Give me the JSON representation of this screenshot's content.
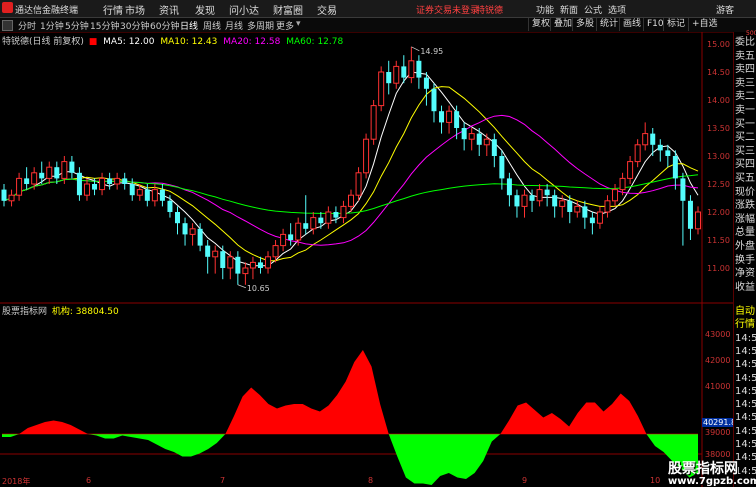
{
  "app": {
    "title": "通达信金融终端"
  },
  "menu": [
    "行情",
    "市场",
    "资讯",
    "发现",
    "问小达",
    "财富圈",
    "交易"
  ],
  "notice": {
    "login": "证券交易未登录",
    "stock": "特锐德"
  },
  "right_menu": [
    "功能",
    "新面",
    "公式",
    "选项",
    "游客"
  ],
  "toolbar": {
    "periods": [
      "分时",
      "1分钟",
      "5分钟",
      "15分钟",
      "30分钟",
      "60分钟",
      "日线",
      "周线",
      "月线",
      "多周期",
      "更多"
    ],
    "active": "日线",
    "right": [
      "复权",
      "叠加",
      "多股",
      "统计",
      "画线",
      "F10",
      "标记",
      "+自选"
    ]
  },
  "main_chart": {
    "title": "特锐德(日线 前复权)",
    "ma": [
      {
        "label": "MA5: 12.00",
        "color": "#ffffff"
      },
      {
        "label": "MA10: 12.43",
        "color": "#ffff00"
      },
      {
        "label": "MA20: 12.58",
        "color": "#ff00ff"
      },
      {
        "label": "MA60: 12.78",
        "color": "#00ff00"
      }
    ],
    "high_label": "14.95",
    "low_label": "10.65",
    "y_ticks": [
      "15.00",
      "14.50",
      "14.00",
      "13.50",
      "13.00",
      "12.50",
      "12.00",
      "11.50",
      "11.00"
    ]
  },
  "indicator": {
    "title": "股票指标网",
    "label": "机构: 38804.50",
    "current": "40291.8",
    "y_ticks": [
      "43000",
      "42000",
      "41000",
      "40000",
      "39000",
      "38000"
    ]
  },
  "x_axis": [
    "2018年",
    "6",
    "7",
    "8",
    "9",
    "10"
  ],
  "side_panel": {
    "top": "500",
    "items_top": [
      "委比",
      "卖五",
      "卖四",
      "卖三",
      "卖二",
      "卖一",
      "买一",
      "买二",
      "买三",
      "买四",
      "买五",
      "现价",
      "涨跌",
      "涨幅",
      "总量",
      "外盘",
      "换手",
      "净资",
      "收益"
    ],
    "items_bottom": [
      "自动",
      "行情",
      "14:5",
      "14:5",
      "14:5",
      "14:5",
      "14:5",
      "14:5",
      "14:5",
      "14:5",
      "14:5",
      "14:5",
      "14:5"
    ]
  },
  "watermark": {
    "text": "股票指标网",
    "url": "www.7gpzb.com"
  },
  "chart_data": {
    "type": "line",
    "candles": [
      [
        12.4,
        12.2,
        12.5,
        12.1
      ],
      [
        12.2,
        12.3,
        12.4,
        12.1
      ],
      [
        12.3,
        12.6,
        12.7,
        12.2
      ],
      [
        12.6,
        12.5,
        12.8,
        12.4
      ],
      [
        12.5,
        12.7,
        12.8,
        12.4
      ],
      [
        12.7,
        12.6,
        12.9,
        12.5
      ],
      [
        12.6,
        12.8,
        12.9,
        12.5
      ],
      [
        12.8,
        12.6,
        12.9,
        12.5
      ],
      [
        12.6,
        12.9,
        13.0,
        12.5
      ],
      [
        12.9,
        12.7,
        13.0,
        12.6
      ],
      [
        12.7,
        12.3,
        12.8,
        12.2
      ],
      [
        12.3,
        12.5,
        12.6,
        12.2
      ],
      [
        12.5,
        12.4,
        12.6,
        12.3
      ],
      [
        12.4,
        12.6,
        12.7,
        12.3
      ],
      [
        12.6,
        12.5,
        12.7,
        12.4
      ],
      [
        12.5,
        12.6,
        12.7,
        12.4
      ],
      [
        12.6,
        12.5,
        12.7,
        12.4
      ],
      [
        12.5,
        12.3,
        12.6,
        12.2
      ],
      [
        12.3,
        12.4,
        12.5,
        12.2
      ],
      [
        12.4,
        12.2,
        12.5,
        12.1
      ],
      [
        12.2,
        12.4,
        12.5,
        12.1
      ],
      [
        12.4,
        12.2,
        12.5,
        12.1
      ],
      [
        12.2,
        12.0,
        12.3,
        11.9
      ],
      [
        12.0,
        11.8,
        12.1,
        11.6
      ],
      [
        11.8,
        11.6,
        11.9,
        11.4
      ],
      [
        11.6,
        11.7,
        11.8,
        11.4
      ],
      [
        11.7,
        11.4,
        11.8,
        11.3
      ],
      [
        11.4,
        11.2,
        11.5,
        10.9
      ],
      [
        11.2,
        11.3,
        11.4,
        10.9
      ],
      [
        11.3,
        11.0,
        11.4,
        10.8
      ],
      [
        11.0,
        11.2,
        11.3,
        10.8
      ],
      [
        11.2,
        10.9,
        11.3,
        10.7
      ],
      [
        10.9,
        11.0,
        11.1,
        10.7
      ],
      [
        11.0,
        11.1,
        11.2,
        10.8
      ],
      [
        11.1,
        11.0,
        11.2,
        10.9
      ],
      [
        11.0,
        11.2,
        11.3,
        10.9
      ],
      [
        11.2,
        11.4,
        11.5,
        11.1
      ],
      [
        11.4,
        11.6,
        11.7,
        11.3
      ],
      [
        11.6,
        11.5,
        11.8,
        11.4
      ],
      [
        11.5,
        11.8,
        11.9,
        11.4
      ],
      [
        11.8,
        11.7,
        12.3,
        11.6
      ],
      [
        11.7,
        11.9,
        12.0,
        11.6
      ],
      [
        11.9,
        11.8,
        12.0,
        11.7
      ],
      [
        11.8,
        12.0,
        12.1,
        11.7
      ],
      [
        12.0,
        11.9,
        12.1,
        11.8
      ],
      [
        11.9,
        12.1,
        12.2,
        11.8
      ],
      [
        12.1,
        12.3,
        12.4,
        12.0
      ],
      [
        12.3,
        12.7,
        12.8,
        12.2
      ],
      [
        12.7,
        13.3,
        13.4,
        12.6
      ],
      [
        13.3,
        13.9,
        14.0,
        13.2
      ],
      [
        13.9,
        14.5,
        14.6,
        13.8
      ],
      [
        14.5,
        14.3,
        14.7,
        14.1
      ],
      [
        14.3,
        14.6,
        14.7,
        14.2
      ],
      [
        14.6,
        14.4,
        14.8,
        14.3
      ],
      [
        14.4,
        14.7,
        14.95,
        14.3
      ],
      [
        14.7,
        14.4,
        14.8,
        14.2
      ],
      [
        14.4,
        14.2,
        14.5,
        13.9
      ],
      [
        14.2,
        13.8,
        14.3,
        13.6
      ],
      [
        13.8,
        13.6,
        13.9,
        13.4
      ],
      [
        13.6,
        13.8,
        13.9,
        13.4
      ],
      [
        13.8,
        13.5,
        13.9,
        13.3
      ],
      [
        13.5,
        13.3,
        13.6,
        13.1
      ],
      [
        13.3,
        13.4,
        13.5,
        13.1
      ],
      [
        13.4,
        13.2,
        13.5,
        13.0
      ],
      [
        13.2,
        13.3,
        13.4,
        13.0
      ],
      [
        13.3,
        13.0,
        13.4,
        12.8
      ],
      [
        13.0,
        12.6,
        13.1,
        12.4
      ],
      [
        12.6,
        12.3,
        12.7,
        12.1
      ],
      [
        12.3,
        12.1,
        12.4,
        11.9
      ],
      [
        12.1,
        12.3,
        12.4,
        11.9
      ],
      [
        12.3,
        12.2,
        12.4,
        12.0
      ],
      [
        12.2,
        12.4,
        12.5,
        12.1
      ],
      [
        12.4,
        12.3,
        12.5,
        12.1
      ],
      [
        12.3,
        12.1,
        12.4,
        11.9
      ],
      [
        12.1,
        12.2,
        12.3,
        11.9
      ],
      [
        12.2,
        12.0,
        12.3,
        11.8
      ],
      [
        12.0,
        12.1,
        12.2,
        11.9
      ],
      [
        12.1,
        11.9,
        12.2,
        11.7
      ],
      [
        11.9,
        11.8,
        12.0,
        11.6
      ],
      [
        11.8,
        12.0,
        12.1,
        11.7
      ],
      [
        12.0,
        12.2,
        12.3,
        11.9
      ],
      [
        12.2,
        12.4,
        12.5,
        12.1
      ],
      [
        12.4,
        12.6,
        12.7,
        12.3
      ],
      [
        12.6,
        12.9,
        13.0,
        12.5
      ],
      [
        12.9,
        13.2,
        13.3,
        12.8
      ],
      [
        13.2,
        13.4,
        13.6,
        13.1
      ],
      [
        13.4,
        13.2,
        13.5,
        13.0
      ],
      [
        13.2,
        13.1,
        13.3,
        12.9
      ],
      [
        13.1,
        13.0,
        13.2,
        12.8
      ],
      [
        13.0,
        12.6,
        13.1,
        12.4
      ],
      [
        12.6,
        12.2,
        12.7,
        11.4
      ],
      [
        12.2,
        11.7,
        12.3,
        11.5
      ],
      [
        11.7,
        12.0,
        12.1,
        11.6
      ]
    ],
    "indicator_values": [
      -0.2,
      -0.2,
      0,
      0.4,
      0.6,
      0.8,
      0.9,
      0.8,
      0.6,
      0.3,
      0,
      -0.1,
      -0.3,
      -0.3,
      -0.1,
      -0.2,
      -0.3,
      -0.4,
      -0.7,
      -1.0,
      -1.2,
      -1.5,
      -1.5,
      -1.3,
      -1.0,
      -0.6,
      0,
      1.2,
      2.5,
      3.1,
      2.6,
      2.0,
      1.7,
      1.9,
      2.0,
      2.0,
      1.7,
      1.5,
      1.9,
      2.6,
      3.5,
      4.8,
      5.6,
      4.5,
      2.0,
      0,
      -1.5,
      -2.9,
      -3.3,
      -3.3,
      -3.4,
      -2.8,
      -2.6,
      -2.9,
      -3.0,
      -2.6,
      -1.8,
      -0.5,
      0,
      0.9,
      1.9,
      2.1,
      1.6,
      1.1,
      1.4,
      1.0,
      0.5,
      1.4,
      2.1,
      2.1,
      1.5,
      2.0,
      2.7,
      2.2,
      1.2,
      0,
      -0.8,
      -1.2,
      -1.8,
      -2.3,
      -2.9,
      -2.6
    ]
  }
}
